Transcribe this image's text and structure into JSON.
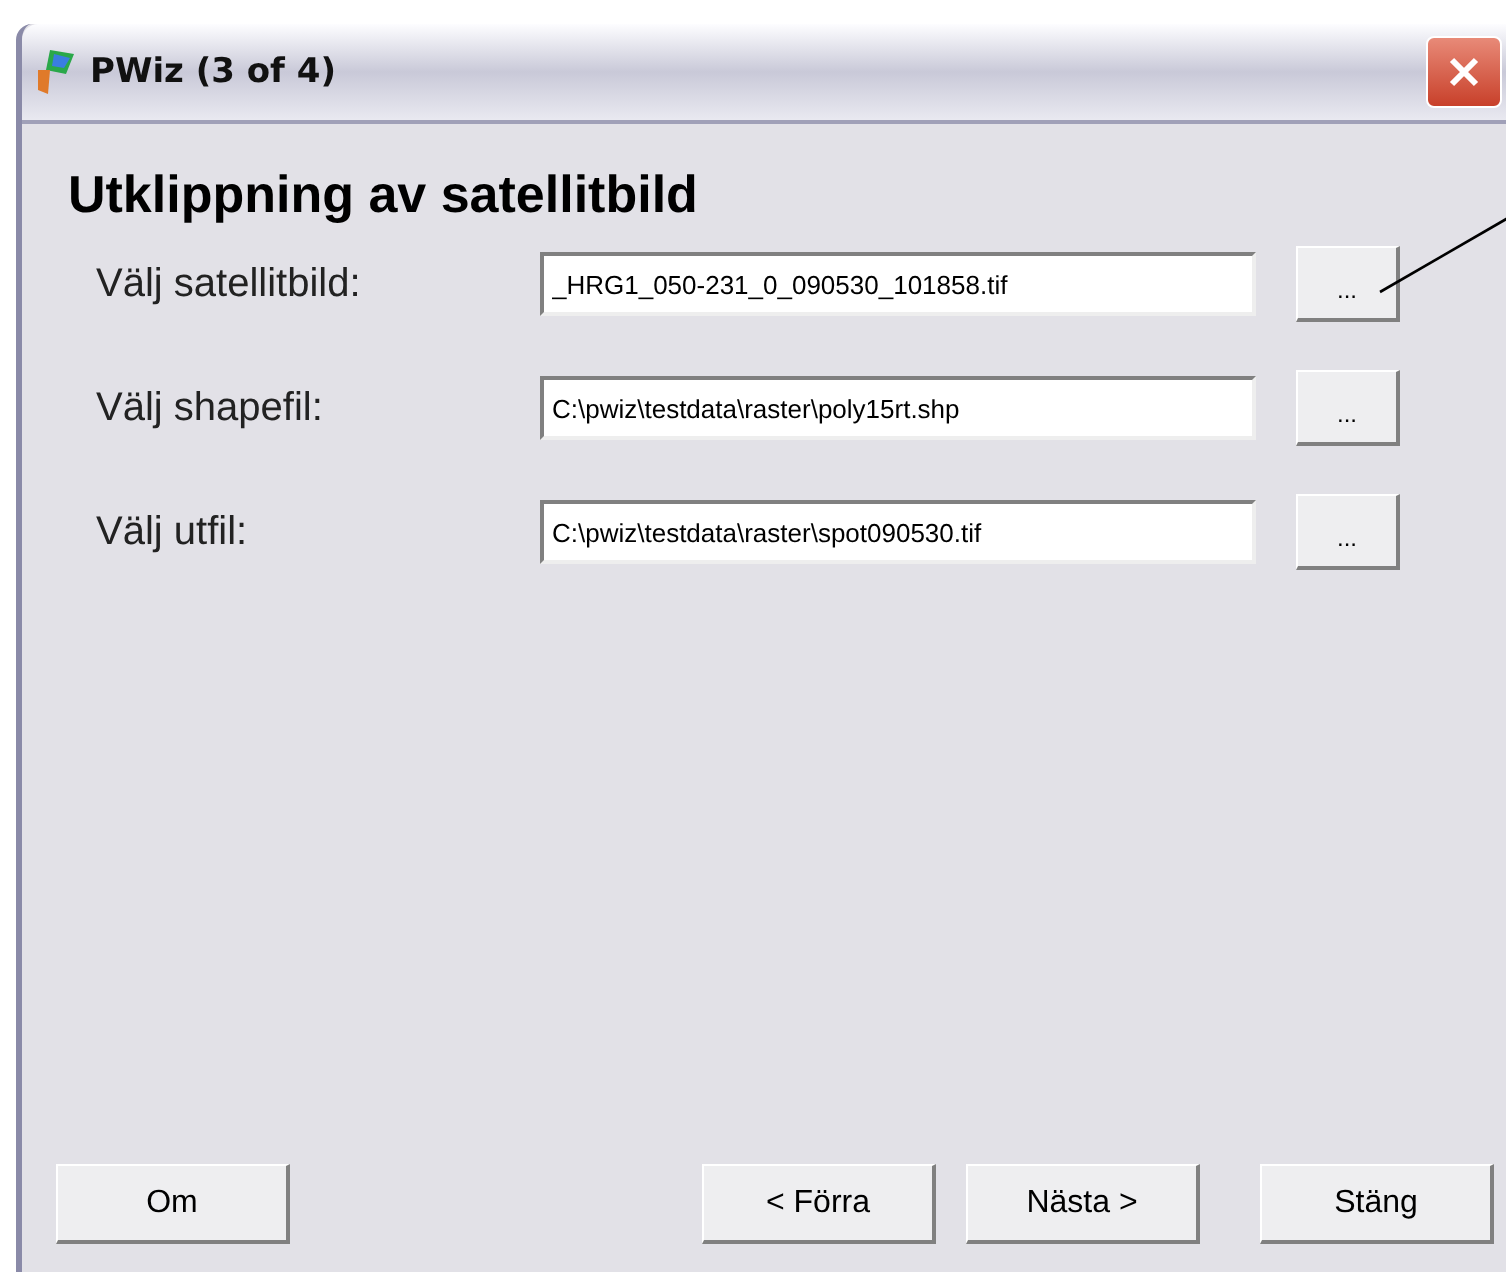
{
  "window": {
    "title": "PWiz (3 of 4)"
  },
  "heading": "Utklippning av satellitbild",
  "rows": [
    {
      "label": "Välj satellitbild:",
      "value": "_HRG1_050-231_0_090530_101858.tif",
      "browse": "..."
    },
    {
      "label": "Välj shapefil:",
      "value": "C:\\pwiz\\testdata\\raster\\poly15rt.shp",
      "browse": "..."
    },
    {
      "label": "Välj utfil:",
      "value": "C:\\pwiz\\testdata\\raster\\spot090530.tif",
      "browse": "..."
    }
  ],
  "buttons": {
    "left": [
      "Om"
    ],
    "right": [
      "< Förra",
      "Nästa >",
      "Stäng"
    ]
  }
}
